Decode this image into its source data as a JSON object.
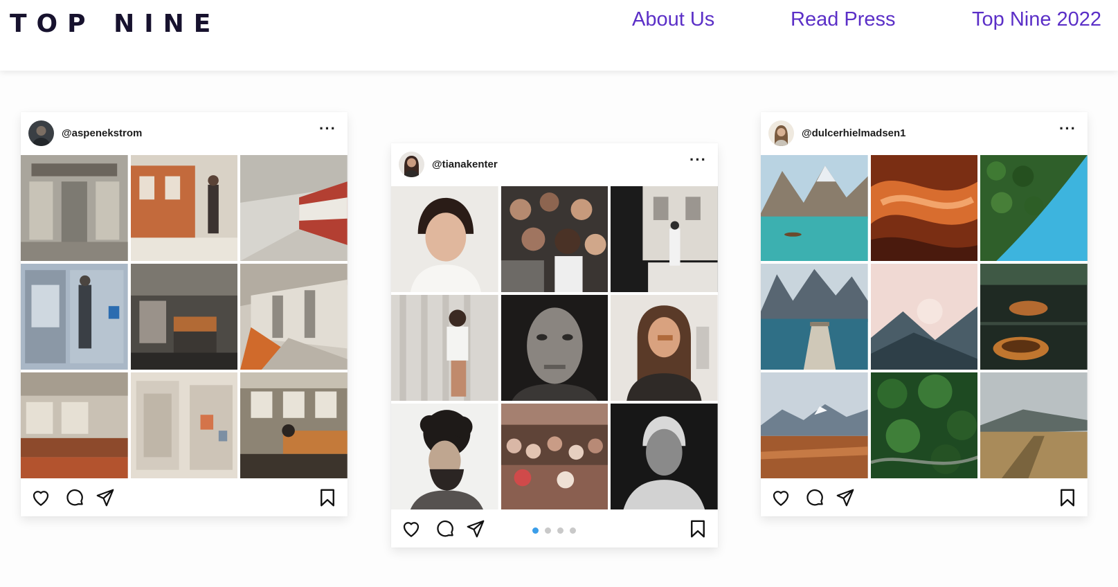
{
  "site": {
    "logo": "TOP NINE",
    "nav": [
      "About Us",
      "Read Press",
      "Top Nine 2022"
    ]
  },
  "colors": {
    "nav_link": "#5b2fc7",
    "logo": "#17122e",
    "carousel_active": "#3b9ee9",
    "carousel_inactive": "#c9c9c9"
  },
  "cards": [
    {
      "username": "@aspenekstrom",
      "more_icon": "more-horizontal-icon",
      "photo_theme": "subway trains and stations",
      "carousel_dots": 0,
      "carousel_active": null
    },
    {
      "username": "@tianakenter",
      "more_icon": "more-horizontal-icon",
      "photo_theme": "portraits and crowds",
      "carousel_dots": 4,
      "carousel_active": 1
    },
    {
      "username": "@dulcerhielmadsen1",
      "more_icon": "more-horizontal-icon",
      "photo_theme": "mountains, lakes and landscapes",
      "carousel_dots": 0,
      "carousel_active": null
    }
  ],
  "actions": {
    "like_icon": "heart-icon",
    "comment_icon": "comment-icon",
    "share_icon": "send-icon",
    "save_icon": "bookmark-icon"
  }
}
